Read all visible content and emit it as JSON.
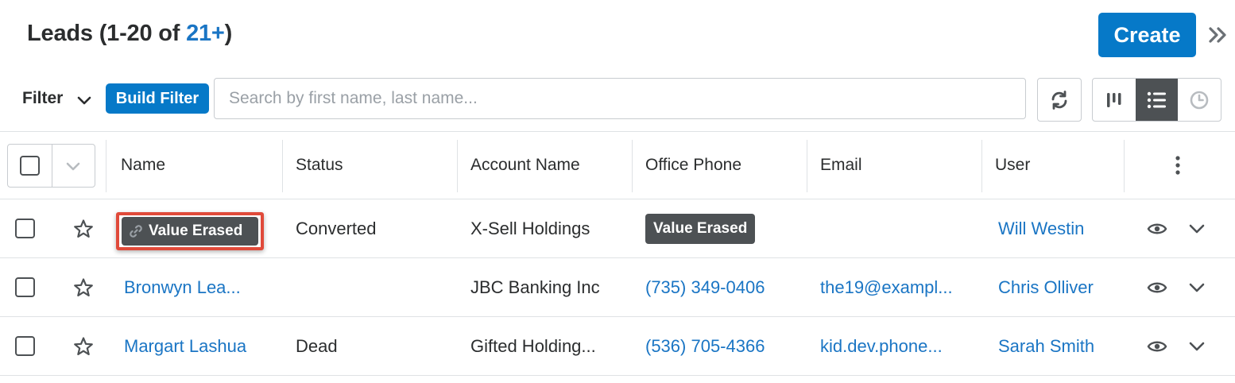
{
  "header": {
    "title": "Leads",
    "range": "(1-20 of ",
    "count": "21+",
    "range_close": ")",
    "create_label": "Create"
  },
  "filterbar": {
    "filter_label": "Filter",
    "build_filter_label": "Build Filter",
    "search_placeholder": "Search by first name, last name..."
  },
  "columns": [
    "Name",
    "Status",
    "Account Name",
    "Office Phone",
    "Email",
    "User"
  ],
  "rows": [
    {
      "name": "Value Erased",
      "status": "Converted",
      "account": "X-Sell Holdings",
      "phone": "Value Erased",
      "email": "",
      "user": "Will Westin"
    },
    {
      "name": "Bronwyn Lea...",
      "status": "",
      "account": "JBC Banking Inc",
      "phone": "(735) 349-0406",
      "email": "the19@exampl...",
      "user": "Chris Olliver"
    },
    {
      "name": "Margart Lashua",
      "status": "Dead",
      "account": "Gifted Holding...",
      "phone": "(536) 705-4366",
      "email": "kid.dev.phone...",
      "user": "Sarah Smith"
    }
  ],
  "colors": {
    "accent": "#0679c8",
    "link": "#1a75c4",
    "erased_badge": "#4d5154",
    "highlight": "#e04a3a"
  },
  "icons": [
    "collapse-double-chevron-icon",
    "chevron-down-icon",
    "refresh-icon",
    "tile-view-icon",
    "list-view-icon",
    "activity-timeline-icon",
    "star-icon",
    "link-icon",
    "eye-icon",
    "kebab-icon"
  ]
}
